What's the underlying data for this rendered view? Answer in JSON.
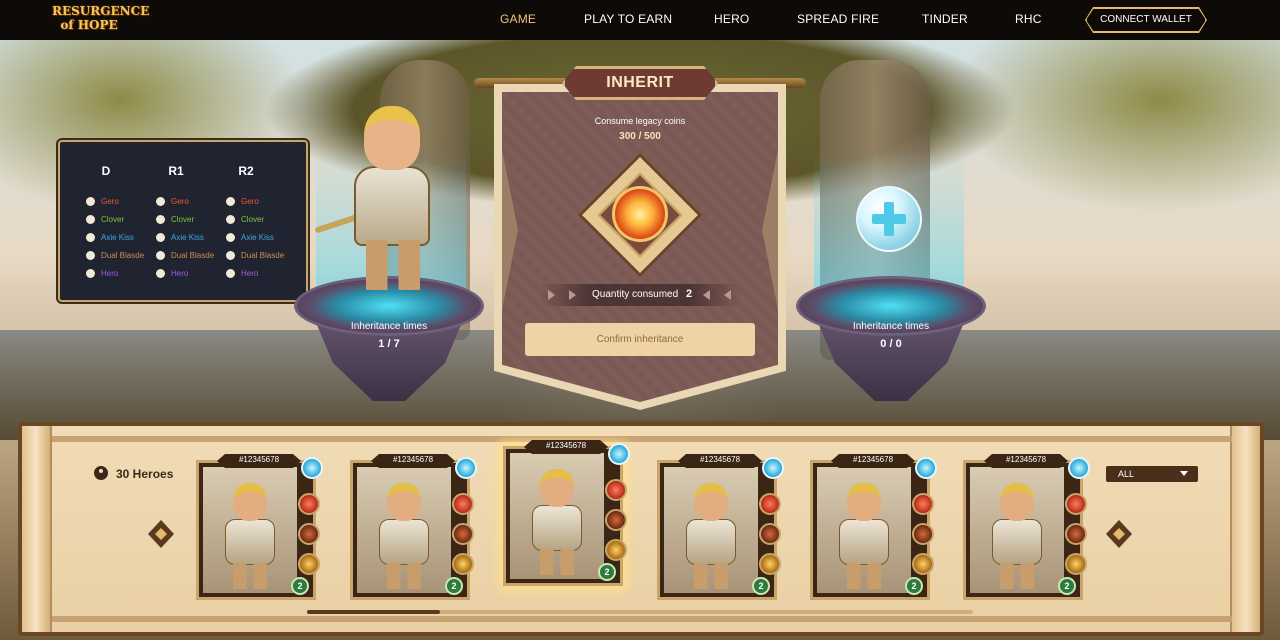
{
  "nav": {
    "logo_line1": "RESURGENCE",
    "logo_line2": "of HOPE",
    "items": [
      {
        "label": "GAME",
        "active": true
      },
      {
        "label": "PLAY TO EARN"
      },
      {
        "label": "HERO"
      },
      {
        "label": "SPREAD FIRE"
      },
      {
        "label": "TINDER"
      },
      {
        "label": "RHC"
      }
    ],
    "connect_wallet": "CONNECT WALLET"
  },
  "filters": {
    "columns": [
      {
        "header": "D",
        "options": [
          {
            "label": "Gero",
            "color": "#f0563c"
          },
          {
            "label": "Clover",
            "color": "#7cc63a"
          },
          {
            "label": "Axie Kiss",
            "color": "#3aa7e6"
          },
          {
            "label": "Dual Blasde",
            "color": "#d08a52"
          },
          {
            "label": "Hero",
            "color": "#a05ae0"
          }
        ]
      },
      {
        "header": "R1",
        "options": [
          {
            "label": "Gero",
            "color": "#f0563c"
          },
          {
            "label": "Clover",
            "color": "#7cc63a"
          },
          {
            "label": "Axie Kiss",
            "color": "#3aa7e6"
          },
          {
            "label": "Dual Blasde",
            "color": "#d08a52"
          },
          {
            "label": "Hero",
            "color": "#a05ae0"
          }
        ]
      },
      {
        "header": "R2",
        "options": [
          {
            "label": "Gero",
            "color": "#f0563c"
          },
          {
            "label": "Clover",
            "color": "#7cc63a"
          },
          {
            "label": "Axie Kiss",
            "color": "#3aa7e6"
          },
          {
            "label": "Dual Blasde",
            "color": "#d08a52"
          },
          {
            "label": "Hero",
            "color": "#a05ae0"
          }
        ]
      }
    ]
  },
  "left_platform": {
    "label": "Inheritance times",
    "value": "1 / 7"
  },
  "right_platform": {
    "label": "Inheritance times",
    "value": "0 / 0"
  },
  "inherit": {
    "title": "INHERIT",
    "consume_label": "Consume legacy coins",
    "consume_value": "300 / 500",
    "quantity_label": "Quantity consumed",
    "quantity_value": "2",
    "confirm_button": "Confirm inheritance"
  },
  "roster": {
    "count_label": "30 Heroes",
    "filter_select": "ALL",
    "cards": [
      {
        "id": "#12345678",
        "level": "2",
        "selected": false
      },
      {
        "id": "#12345678",
        "level": "2",
        "selected": false
      },
      {
        "id": "#12345678",
        "level": "2",
        "selected": true
      },
      {
        "id": "#12345678",
        "level": "2",
        "selected": false
      },
      {
        "id": "#12345678",
        "level": "2",
        "selected": false
      },
      {
        "id": "#12345678",
        "level": "2",
        "selected": false
      }
    ]
  },
  "colors": {
    "accent_gold": "#e6b86e",
    "nav_active": "#f0c27a",
    "panel_dark": "#1f2430",
    "parchment": "#f1dcb7"
  }
}
